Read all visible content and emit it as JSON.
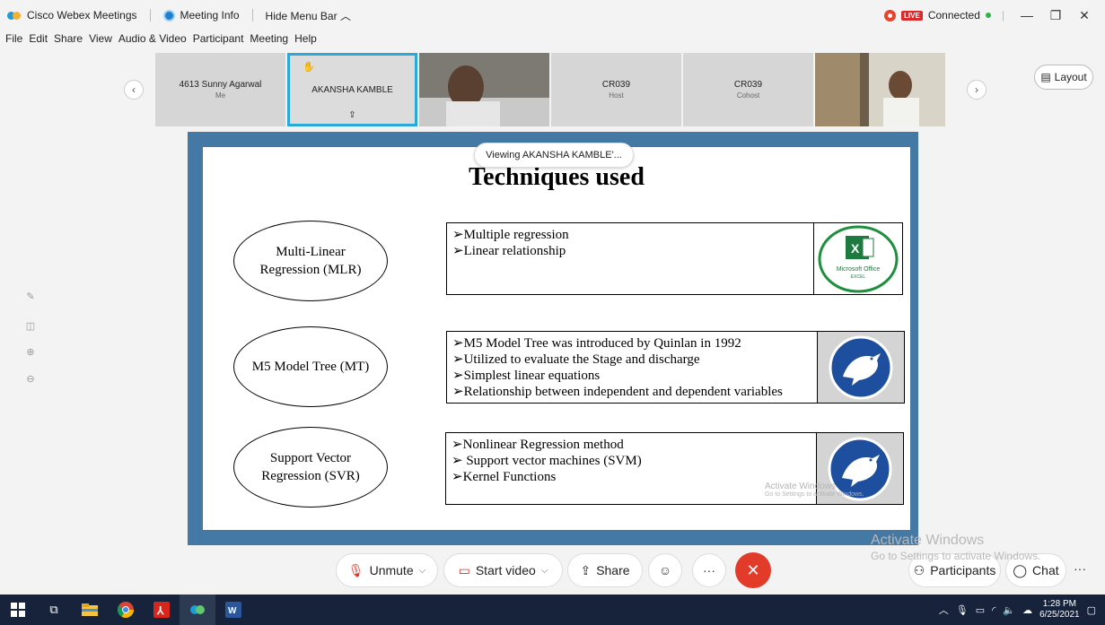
{
  "window": {
    "app_title": "Cisco Webex Meetings",
    "meeting_info": "Meeting Info",
    "hide_menu": "Hide Menu Bar",
    "live_badge": "LIVE",
    "status": "Connected"
  },
  "menu": [
    "File",
    "Edit",
    "Share",
    "View",
    "Audio & Video",
    "Participant",
    "Meeting",
    "Help"
  ],
  "participants": [
    {
      "name": "4613 Sunny Agarwal",
      "role": "Me"
    },
    {
      "name": "AKANSHA KAMBLE",
      "role": ""
    },
    {
      "name": "",
      "role": ""
    },
    {
      "name": "CR039",
      "role": "Host"
    },
    {
      "name": "CR039",
      "role": "Cohost"
    },
    {
      "name": "",
      "role": ""
    }
  ],
  "layout_label": "Layout",
  "viewing_label": "Viewing AKANSHA KAMBLE'...",
  "slide": {
    "title": "Techniques used",
    "rows": [
      {
        "method": "Multi-Linear Regression (MLR)",
        "bullets": [
          "Multiple regression",
          "Linear relationship"
        ],
        "icon": "excel"
      },
      {
        "method": "M5 Model Tree (MT)",
        "bullets": [
          "M5 Model Tree was introduced by Quinlan in 1992",
          "Utilized to evaluate the Stage and discharge",
          "Simplest linear equations",
          "Relationship between independent and dependent variables"
        ],
        "icon": "weka"
      },
      {
        "method": "Support Vector Regression (SVR)",
        "bullets": [
          "Nonlinear Regression method",
          " Support vector machines (SVM)",
          "Kernel Functions"
        ],
        "icon": "weka"
      }
    ],
    "excel_caption": "Microsoft Office",
    "excel_sub": "EXCEL",
    "activate_text": "Activate Windows",
    "activate_sub": "Go to Settings to activate Windows."
  },
  "overlay": {
    "activate_title": "Activate Windows",
    "activate_sub": "Go to Settings to activate Windows."
  },
  "controls": {
    "unmute": "Unmute",
    "start_video": "Start video",
    "share": "Share",
    "participants": "Participants",
    "chat": "Chat"
  },
  "taskbar": {
    "time": "1:28 PM",
    "date": "6/25/2021"
  }
}
